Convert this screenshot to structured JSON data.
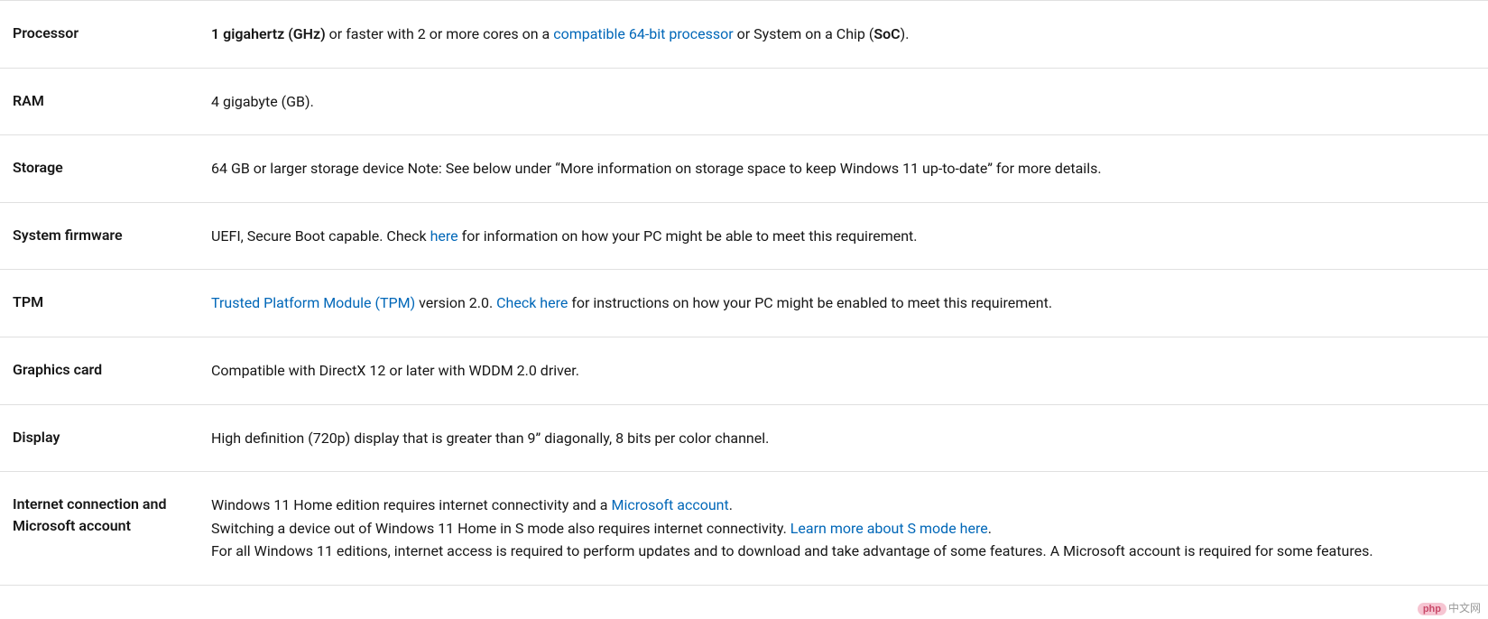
{
  "rows": [
    {
      "label": "Processor",
      "parts": [
        {
          "kind": "bold",
          "text": "1 gigahertz (GHz)"
        },
        {
          "kind": "text",
          "text": " or faster with 2 or more cores on a "
        },
        {
          "kind": "link",
          "text": "compatible 64-bit processor"
        },
        {
          "kind": "text",
          "text": " or System on a Chip ("
        },
        {
          "kind": "bold",
          "text": "SoC"
        },
        {
          "kind": "text",
          "text": ")."
        }
      ]
    },
    {
      "label": "RAM",
      "parts": [
        {
          "kind": "text",
          "text": "4 gigabyte (GB)."
        }
      ]
    },
    {
      "label": "Storage",
      "parts": [
        {
          "kind": "text",
          "text": "64 GB or larger storage device Note: See below under “More information on storage space to keep Windows 11 up-to-date” for more details."
        }
      ]
    },
    {
      "label": "System firmware",
      "parts": [
        {
          "kind": "text",
          "text": "UEFI, Secure Boot capable. Check "
        },
        {
          "kind": "link",
          "text": "here"
        },
        {
          "kind": "text",
          "text": " for information on how your PC might be able to meet this requirement."
        }
      ]
    },
    {
      "label": "TPM",
      "parts": [
        {
          "kind": "link",
          "text": "Trusted Platform Module (TPM)"
        },
        {
          "kind": "text",
          "text": " version 2.0. "
        },
        {
          "kind": "link",
          "text": "Check here"
        },
        {
          "kind": "text",
          "text": " for instructions on how your PC might be enabled to meet this requirement."
        }
      ]
    },
    {
      "label": "Graphics card",
      "parts": [
        {
          "kind": "text",
          "text": "Compatible with DirectX 12 or later with WDDM 2.0 driver."
        }
      ]
    },
    {
      "label": "Display",
      "parts": [
        {
          "kind": "text",
          "text": "High definition (720p) display that is greater than 9” diagonally, 8 bits per color channel."
        }
      ]
    },
    {
      "label": "Internet connection and Microsoft account",
      "parts": [
        {
          "kind": "text",
          "text": "Windows 11 Home edition requires internet connectivity and a "
        },
        {
          "kind": "link",
          "text": "Microsoft account"
        },
        {
          "kind": "text",
          "text": "."
        },
        {
          "kind": "br"
        },
        {
          "kind": "text",
          "text": "Switching a device out of Windows 11 Home in S mode also requires internet connectivity. "
        },
        {
          "kind": "link",
          "text": "Learn more about S mode here"
        },
        {
          "kind": "text",
          "text": "."
        },
        {
          "kind": "br"
        },
        {
          "kind": "text",
          "text": "For all Windows 11 editions, internet access is required to perform updates and to download and take advantage of some features. A Microsoft account is required for some features."
        }
      ]
    }
  ],
  "watermark": {
    "badge": "php",
    "text": "中文网"
  }
}
